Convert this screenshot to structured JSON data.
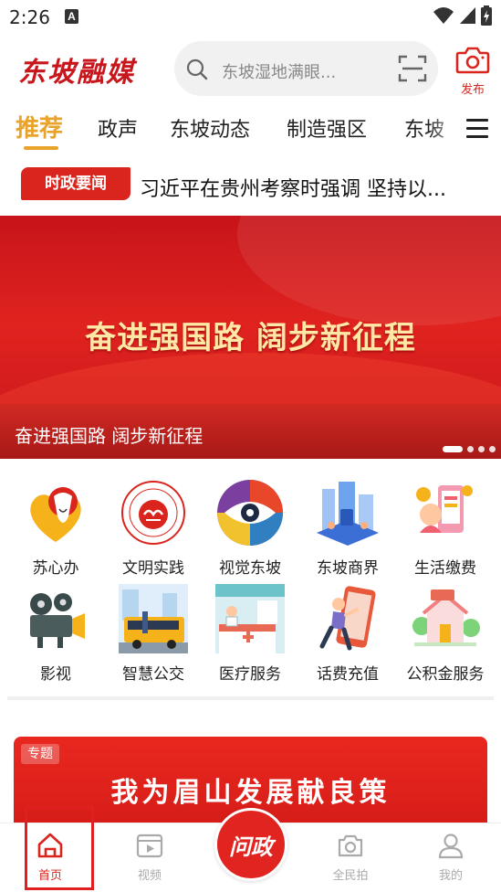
{
  "status_bar": {
    "time": "2:26",
    "notification_badge": "A"
  },
  "header": {
    "logo_text": "东坡融媒",
    "search_placeholder": "东坡湿地满眼...",
    "publish_label": "发布"
  },
  "tabs": {
    "items": [
      {
        "label": "推荐",
        "active": true
      },
      {
        "label": "政声",
        "active": false
      },
      {
        "label": "东坡动态",
        "active": false
      },
      {
        "label": "制造强区",
        "active": false
      },
      {
        "label": "东坡",
        "active": false
      }
    ]
  },
  "ticker": {
    "badge": "时政要闻",
    "headline": "习近平在贵州考察时强调 坚持以..."
  },
  "banner": {
    "headline": "奋进强国路 阔步新征程",
    "caption": "奋进强国路 阔步新征程",
    "slide_count": 4,
    "active_slide": 1
  },
  "services": [
    {
      "label": "苏心办",
      "icon": "suxinban-icon"
    },
    {
      "label": "文明实践",
      "icon": "wenming-icon"
    },
    {
      "label": "视觉东坡",
      "icon": "eye-icon"
    },
    {
      "label": "东坡商界",
      "icon": "business-icon"
    },
    {
      "label": "生活缴费",
      "icon": "payment-icon"
    },
    {
      "label": "影视",
      "icon": "film-projector-icon"
    },
    {
      "label": "智慧公交",
      "icon": "bus-icon"
    },
    {
      "label": "医疗服务",
      "icon": "medical-icon"
    },
    {
      "label": "话费充值",
      "icon": "phone-topup-icon"
    },
    {
      "label": "公积金服务",
      "icon": "housing-fund-icon"
    }
  ],
  "feature": {
    "tag": "专题",
    "title": "我为眉山发展献良策"
  },
  "bottom_nav": {
    "items": [
      {
        "label": "首页",
        "icon": "home-icon",
        "active": true
      },
      {
        "label": "视频",
        "icon": "video-icon",
        "active": false
      },
      {
        "label": "全民拍",
        "icon": "camera-icon",
        "active": false
      },
      {
        "label": "我的",
        "icon": "user-icon",
        "active": false
      }
    ],
    "center_label": "问政"
  },
  "colors": {
    "brand_red": "#d9251d",
    "tab_active": "#e8a32a",
    "banner_text": "#ffe7a6"
  }
}
